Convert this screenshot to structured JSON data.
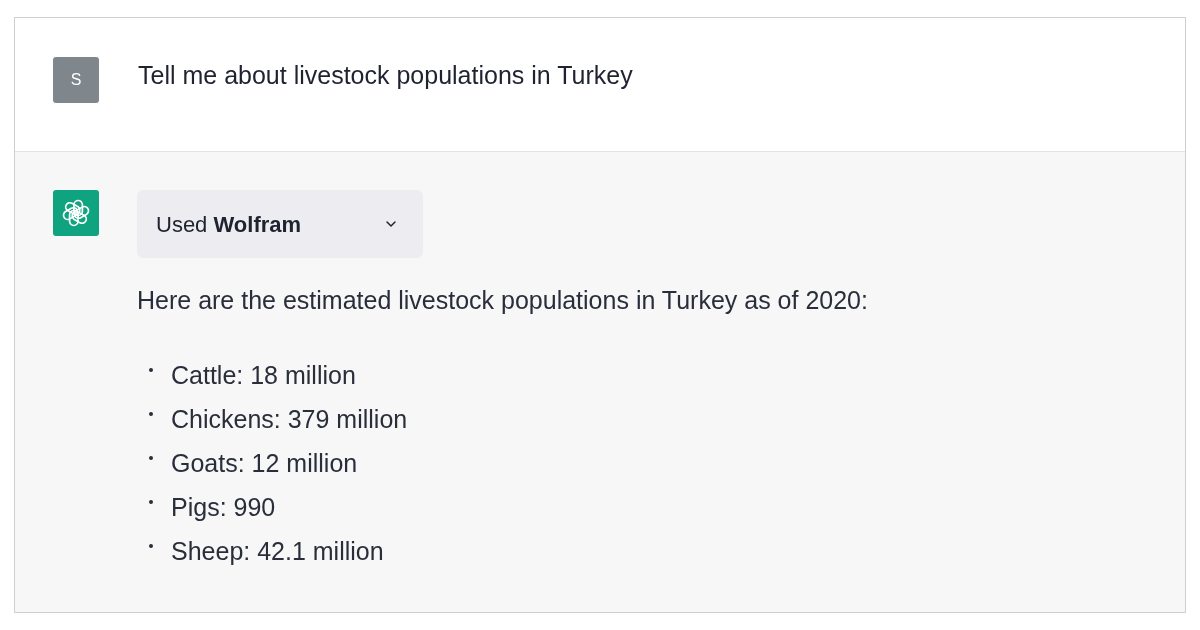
{
  "conversation": [
    {
      "kind": "user",
      "avatar": "S",
      "text": "Tell me about livestock populations in Turkey"
    },
    {
      "kind": "assistant",
      "tool_use": {
        "label": "Used **Wolfram**",
        "expanded": false
      },
      "intro": "Here are the estimated livestock populations in Turkey as of 2020:",
      "items": [
        "Cattle: 18 million",
        "Chickens: 379 million",
        "Goats: 12 million",
        "Pigs: 990",
        "Sheep: 42.1 million"
      ]
    }
  ]
}
